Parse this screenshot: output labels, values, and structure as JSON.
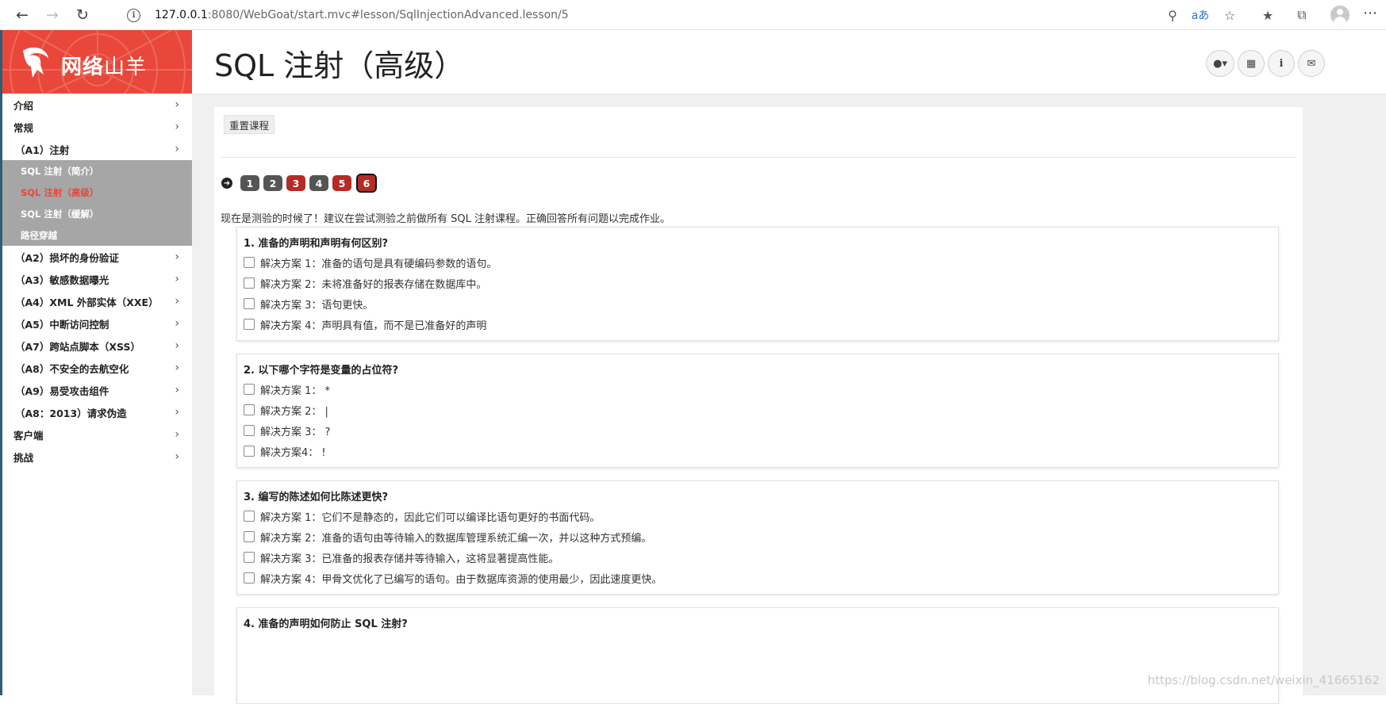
{
  "browser": {
    "url_host": "127.0.0.1",
    "url_rest": ":8080/WebGoat/start.mvc#lesson/SqlInjectionAdvanced.lesson/5"
  },
  "logo": {
    "bold": "网络",
    "light": "山羊"
  },
  "sidebar": {
    "items": [
      {
        "label": "介绍"
      },
      {
        "label": "常规"
      },
      {
        "label": "（A1）注射"
      }
    ],
    "sub_items": [
      {
        "label": "SQL 注射（简介）"
      },
      {
        "label": "SQL 注射（高级）"
      },
      {
        "label": "SQL 注射（缓解）"
      },
      {
        "label": "路径穿越"
      }
    ],
    "items_after": [
      {
        "label": "（A2）损坏的身份验证"
      },
      {
        "label": "（A3）敏感数据曝光"
      },
      {
        "label": "（A4）XML 外部实体（XXE）"
      },
      {
        "label": "（A5）中断访问控制"
      },
      {
        "label": "（A7）跨站点脚本（XSS）"
      },
      {
        "label": "（A8）不安全的去航空化"
      },
      {
        "label": "（A9）易受攻击组件"
      },
      {
        "label": "（A8：2013）请求伪造"
      },
      {
        "label": "客户端"
      },
      {
        "label": "挑战"
      }
    ]
  },
  "header": {
    "title": "SQL 注射（高级）"
  },
  "lesson": {
    "reset_label": "重置课程",
    "pages": [
      "1",
      "2",
      "3",
      "4",
      "5",
      "6"
    ],
    "intro": "现在是测验的时候了！建议在尝试测验之前做所有 SQL 注射课程。正确回答所有问题以完成作业。",
    "questions": [
      {
        "title": "1. 准备的声明和声明有何区别?",
        "options": [
          "解决方案 1：准备的语句是具有硬编码参数的语句。",
          "解决方案 2：未将准备好的报表存储在数据库中。",
          "解决方案 3：语句更快。",
          "解决方案 4：声明具有值，而不是已准备好的声明"
        ]
      },
      {
        "title": "2. 以下哪个字符是变量的占位符?",
        "options": [
          "解决方案 1：  *",
          "解决方案 2：  |",
          "解决方案 3：  ?",
          "解决方案4：  !"
        ]
      },
      {
        "title": "3. 编写的陈述如何比陈述更快?",
        "options": [
          "解决方案 1：它们不是静态的，因此它们可以编译比语句更好的书面代码。",
          "解决方案 2：准备的语句由等待输入的数据库管理系统汇编一次，并以这种方式预编。",
          "解决方案 3：已准备的报表存储并等待输入，这将显著提高性能。",
          "解决方案 4：甲骨文优化了已编写的语句。由于数据库资源的使用最少，因此速度更快。"
        ]
      },
      {
        "title": "4. 准备的声明如何防止 SQL 注射?",
        "options": []
      }
    ]
  },
  "watermark": "https://blog.csdn.net/weixin_41665162"
}
